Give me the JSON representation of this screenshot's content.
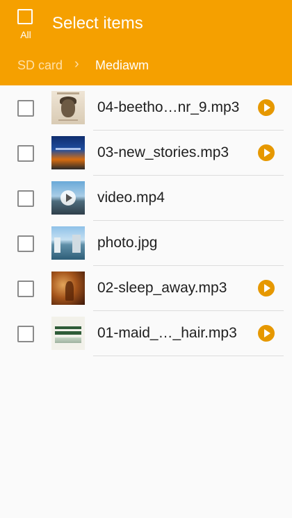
{
  "header": {
    "select_all_label": "All",
    "title": "Select items",
    "accent_color": "#f5a000"
  },
  "breadcrumb": {
    "root": "SD card",
    "separator": "›",
    "current": "Mediawm"
  },
  "files": [
    {
      "name": "04-beetho…nr_9.mp3",
      "type": "audio",
      "thumbnail": "beethoven-album-art",
      "checked": false
    },
    {
      "name": "03-new_stories.mp3",
      "type": "audio",
      "thumbnail": "new-stories-album-art",
      "checked": false
    },
    {
      "name": "video.mp4",
      "type": "video",
      "thumbnail": "harbor-video-frame",
      "checked": false
    },
    {
      "name": "photo.jpg",
      "type": "image",
      "thumbnail": "harbor-photo",
      "checked": false
    },
    {
      "name": "02-sleep_away.mp3",
      "type": "audio",
      "thumbnail": "sleep-away-album-art",
      "checked": false
    },
    {
      "name": "01-maid_…_hair.mp3",
      "type": "audio",
      "thumbnail": "richard-stoltzman-album-art",
      "checked": false
    }
  ]
}
